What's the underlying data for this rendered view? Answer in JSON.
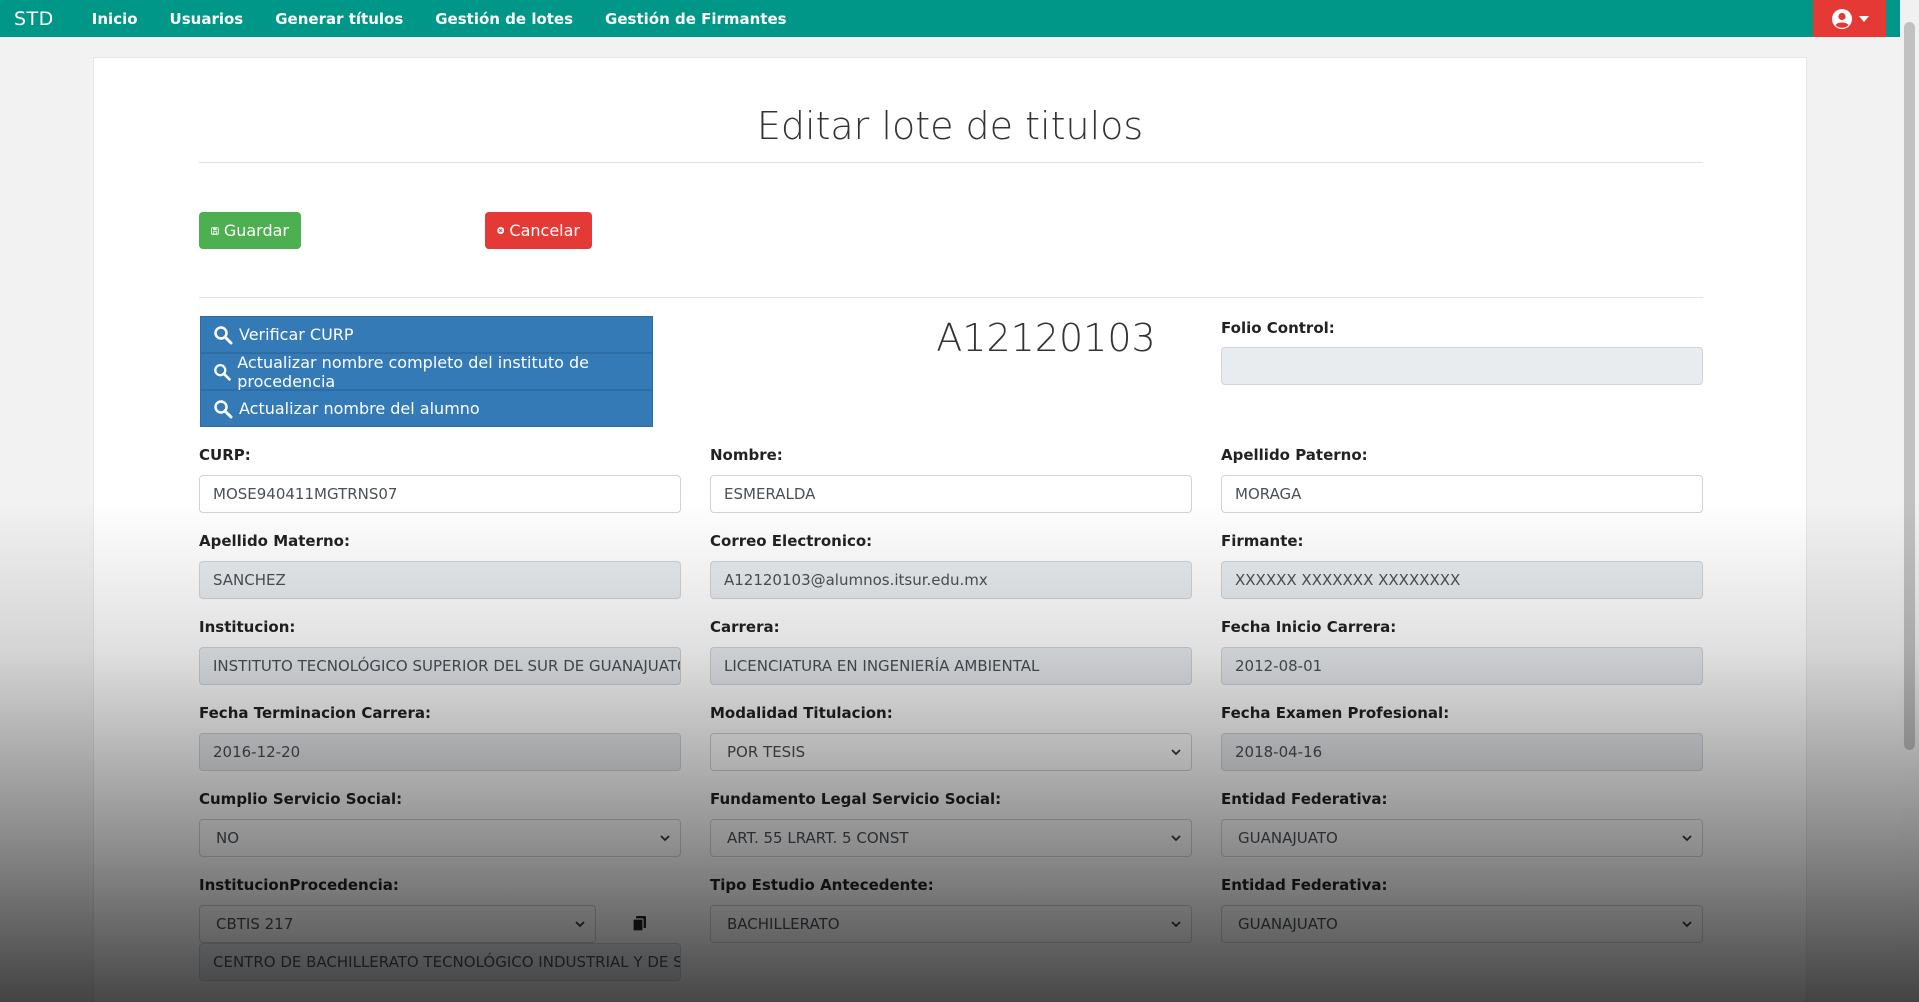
{
  "nav": {
    "brand": "STD",
    "links": [
      "Inicio",
      "Usuarios",
      "Generar títulos",
      "Gestión de lotes",
      "Gestión de Firmantes"
    ],
    "user_icon": "user-circle-icon"
  },
  "page": {
    "title": "Editar lote de titulos",
    "save_label": "Guardar",
    "cancel_label": "Cancelar"
  },
  "actions": {
    "verify_curp": "Verificar CURP",
    "update_institute": "Actualizar nombre completo del instituto de procedencia",
    "update_student": "Actualizar nombre del alumno"
  },
  "record": {
    "id": "A12120103"
  },
  "form": {
    "folio_control": {
      "label": "Folio Control:",
      "value": ""
    },
    "curp": {
      "label": "CURP:",
      "value": "MOSE940411MGTRNS07"
    },
    "nombre": {
      "label": "Nombre:",
      "value": "ESMERALDA"
    },
    "apellido_paterno": {
      "label": "Apellido Paterno:",
      "value": "MORAGA"
    },
    "apellido_materno": {
      "label": "Apellido Materno:",
      "value": "SANCHEZ"
    },
    "correo": {
      "label": "Correo Electronico:",
      "value": "A12120103@alumnos.itsur.edu.mx"
    },
    "firmante": {
      "label": "Firmante:",
      "value": "XXXXXX XXXXXXX XXXXXXXX"
    },
    "institucion": {
      "label": "Institucion:",
      "value": "INSTITUTO TECNOLÓGICO SUPERIOR DEL SUR DE GUANAJUATO"
    },
    "carrera": {
      "label": "Carrera:",
      "value": "LICENCIATURA EN INGENIERÍA AMBIENTAL"
    },
    "fecha_inicio": {
      "label": "Fecha Inicio Carrera:",
      "value": "2012-08-01"
    },
    "fecha_terminacion": {
      "label": "Fecha Terminacion Carrera:",
      "value": "2016-12-20"
    },
    "modalidad": {
      "label": "Modalidad Titulacion:",
      "value": "POR TESIS"
    },
    "fecha_examen": {
      "label": "Fecha Examen Profesional:",
      "value": "2018-04-16"
    },
    "servicio_social": {
      "label": "Cumplio Servicio Social:",
      "value": "NO"
    },
    "fundamento": {
      "label": "Fundamento Legal Servicio Social:",
      "value": "ART. 55 LRART. 5 CONST"
    },
    "entidad1": {
      "label": "Entidad Federativa:",
      "value": "GUANAJUATO"
    },
    "inst_procedencia": {
      "label": "InstitucionProcedencia:",
      "value": "CBTIS 217",
      "full_name": "CENTRO DE BACHILLERATO TECNOLÓGICO INDUSTRIAL Y DE SERVICIOS"
    },
    "tipo_estudio": {
      "label": "Tipo Estudio Antecedente:",
      "value": "BACHILLERATO"
    },
    "entidad2": {
      "label": "Entidad Federativa:",
      "value": "GUANAJUATO"
    }
  },
  "colors": {
    "navbar": "#009688",
    "user_menu": "#e53935",
    "save": "#4caf50",
    "cancel": "#e53935",
    "action_button": "#337ab7"
  }
}
